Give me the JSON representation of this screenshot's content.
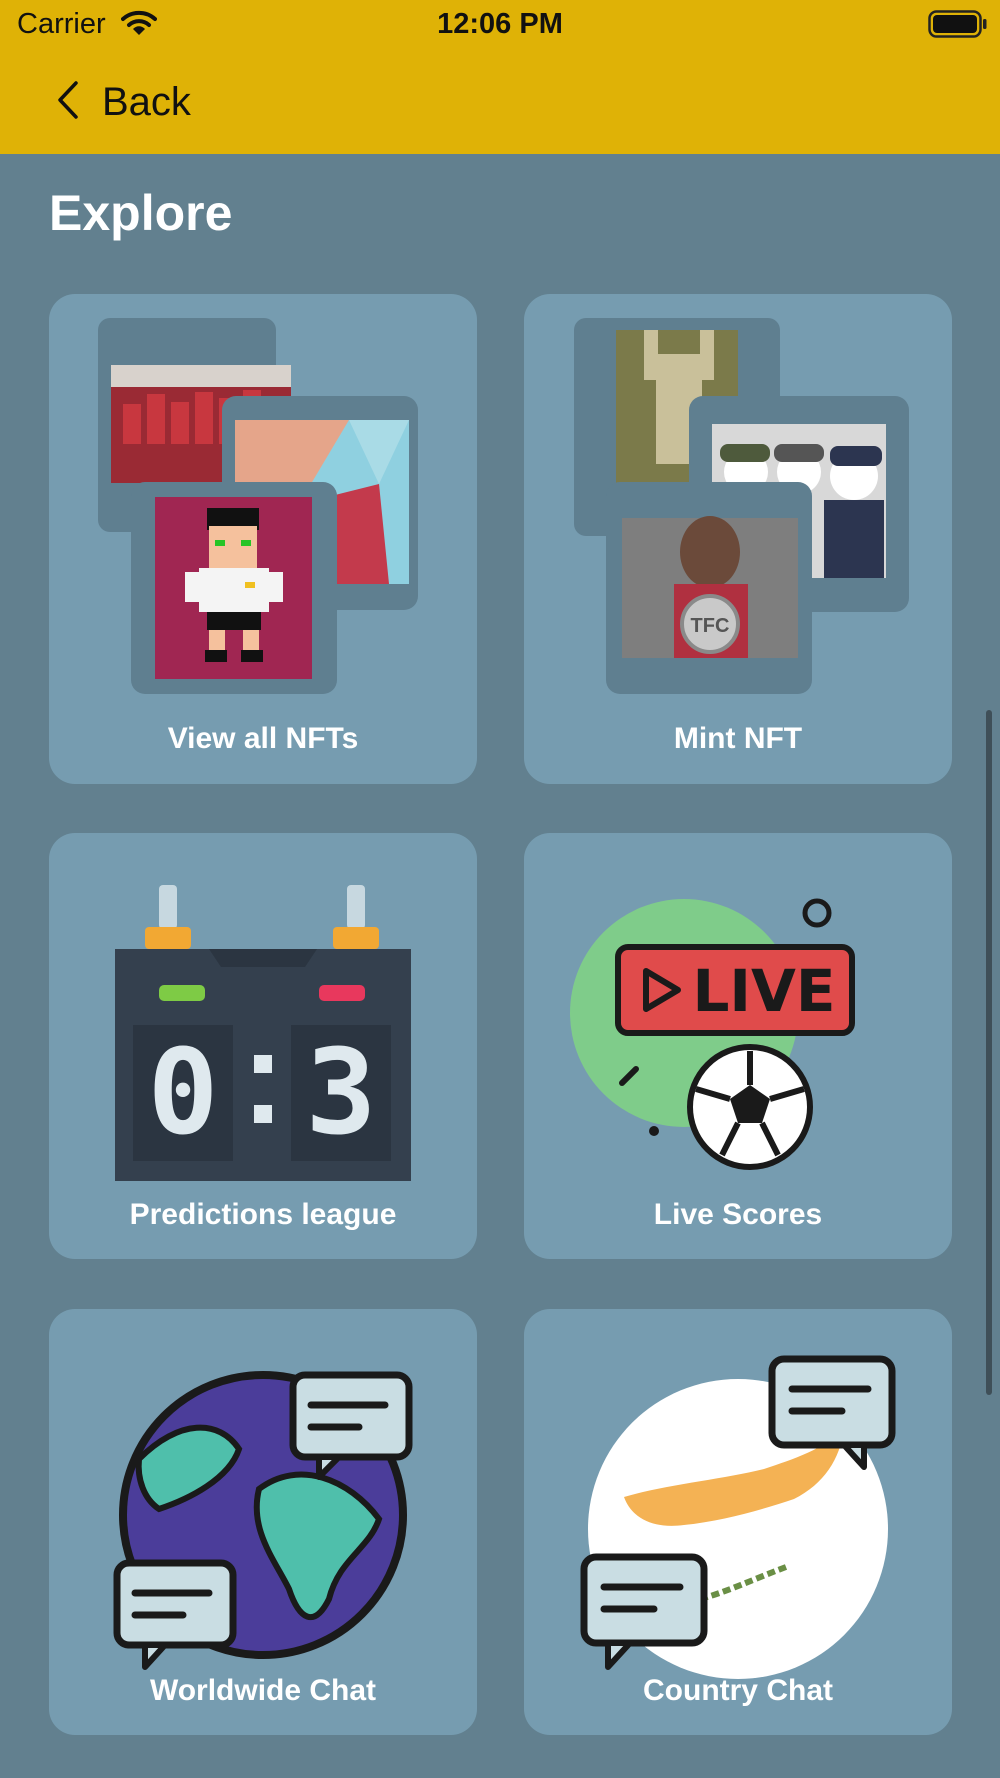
{
  "status_bar": {
    "carrier": "Carrier",
    "time": "12:06 PM"
  },
  "nav": {
    "back_label": "Back"
  },
  "page": {
    "title": "Explore"
  },
  "cards": [
    {
      "label": "View all NFTs",
      "icon": "nft-gallery-image"
    },
    {
      "label": "Mint NFT",
      "icon": "nft-collage-image"
    },
    {
      "label": "Predictions league",
      "icon": "scoreboard-icon",
      "score": "0:3"
    },
    {
      "label": "Live Scores",
      "icon": "live-football-icon",
      "badge": "LIVE"
    },
    {
      "label": "Worldwide Chat",
      "icon": "globe-chat-icon"
    },
    {
      "label": "Country Chat",
      "icon": "cyprus-chat-icon"
    }
  ],
  "colors": {
    "header": "#dfb206",
    "background": "#62808f",
    "card": "#769cb0"
  }
}
